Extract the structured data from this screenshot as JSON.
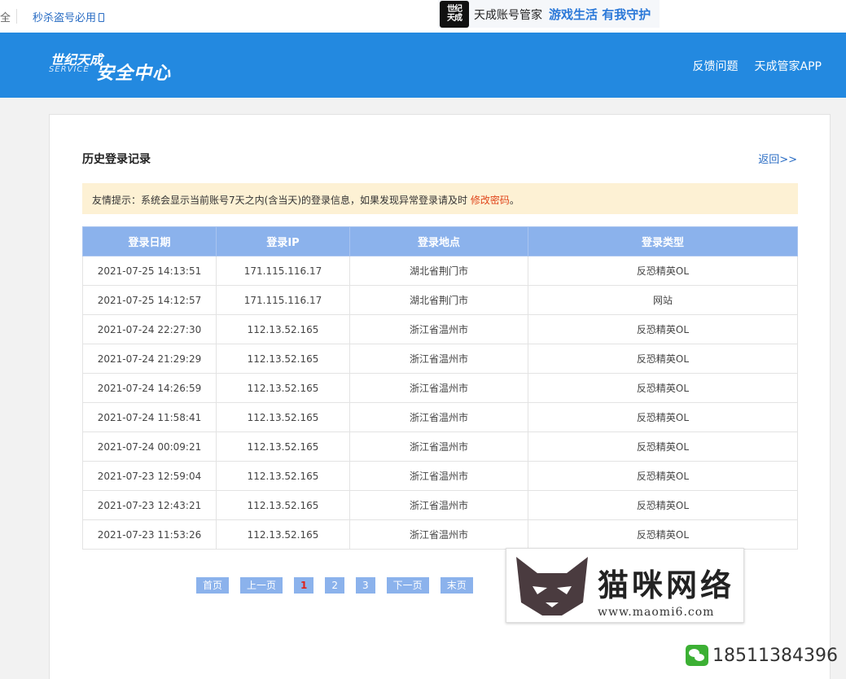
{
  "topbar": {
    "fragment": "全",
    "tip_link": "秒杀盗号必用",
    "banner_logo": "世纪\n天成",
    "banner_text": "天成账号管家",
    "banner_slogan": "游戏生活  有我守护"
  },
  "header": {
    "brand_cn": "世纪天成",
    "brand_en": "SERVICE",
    "brand_main": "安全中心",
    "nav": [
      "反馈问题",
      "天成管家APP"
    ]
  },
  "card": {
    "title": "历史登录记录",
    "back": "返回>>",
    "notice_text": "友情提示：系统会显示当前账号7天之内(含当天)的登录信息，如果发现异常登录请及时 ",
    "notice_link": "修改密码",
    "notice_end": "。"
  },
  "table": {
    "headers": [
      "登录日期",
      "登录IP",
      "登录地点",
      "登录类型"
    ],
    "rows": [
      [
        "2021-07-25 14:13:51",
        "171.115.116.17",
        "湖北省荆门市",
        "反恐精英OL"
      ],
      [
        "2021-07-25 14:12:57",
        "171.115.116.17",
        "湖北省荆门市",
        "网站"
      ],
      [
        "2021-07-24 22:27:30",
        "112.13.52.165",
        "浙江省温州市",
        "反恐精英OL"
      ],
      [
        "2021-07-24 21:29:29",
        "112.13.52.165",
        "浙江省温州市",
        "反恐精英OL"
      ],
      [
        "2021-07-24 14:26:59",
        "112.13.52.165",
        "浙江省温州市",
        "反恐精英OL"
      ],
      [
        "2021-07-24 11:58:41",
        "112.13.52.165",
        "浙江省温州市",
        "反恐精英OL"
      ],
      [
        "2021-07-24 00:09:21",
        "112.13.52.165",
        "浙江省温州市",
        "反恐精英OL"
      ],
      [
        "2021-07-23 12:59:04",
        "112.13.52.165",
        "浙江省温州市",
        "反恐精英OL"
      ],
      [
        "2021-07-23 12:43:21",
        "112.13.52.165",
        "浙江省温州市",
        "反恐精英OL"
      ],
      [
        "2021-07-23 11:53:26",
        "112.13.52.165",
        "浙江省温州市",
        "反恐精英OL"
      ]
    ]
  },
  "pager": {
    "first": "首页",
    "prev": "上一页",
    "pages": [
      "1",
      "2",
      "3"
    ],
    "current": "1",
    "next": "下一页",
    "last": "末页"
  },
  "watermark": {
    "name": "猫咪网络",
    "url": "www.maomi6.com",
    "phone": "18511384396"
  }
}
